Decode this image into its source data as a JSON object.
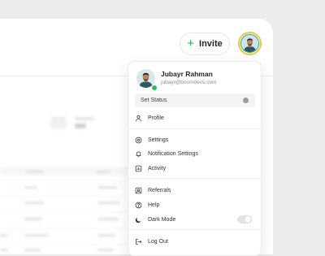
{
  "header": {
    "invite_label": "Invite",
    "avatar_icon": "user-avatar"
  },
  "dropdown": {
    "user": {
      "name": "Jubayr Rahman",
      "email": "jubayr@boomdevs.com",
      "online": true
    },
    "status_label": "Set Status",
    "items": [
      {
        "label": "Profile",
        "icon": "user-icon"
      },
      {
        "label": "Settings",
        "icon": "gear-icon"
      },
      {
        "label": "Notification Settings",
        "icon": "bell-icon"
      },
      {
        "label": "Activity",
        "icon": "activity-icon"
      },
      {
        "label": "Referrals",
        "icon": "referrals-icon"
      },
      {
        "label": "Help",
        "icon": "help-icon"
      },
      {
        "label": "Dark Mode",
        "icon": "moon-icon"
      },
      {
        "label": "Log Out",
        "icon": "logout-icon"
      }
    ],
    "dark_mode_enabled": false
  },
  "background_dashboard": {
    "stat_value": "81"
  },
  "colors": {
    "accent_green": "#2aa64f",
    "online": "#2ebd5b",
    "avatar_ring": "#e9c64a"
  }
}
